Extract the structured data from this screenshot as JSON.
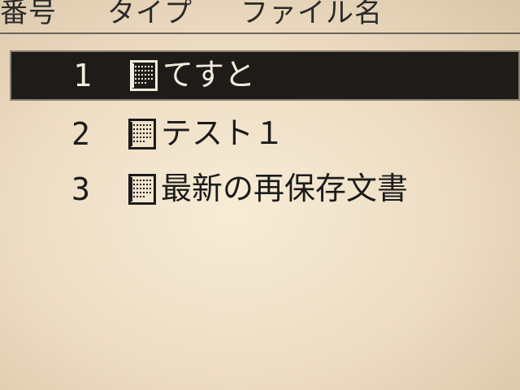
{
  "header": {
    "col_number": "番号",
    "col_type": "タイプ",
    "col_filename": "ファイル名"
  },
  "files": [
    {
      "number": "1",
      "name": "てすと",
      "selected": true
    },
    {
      "number": "2",
      "name": "テスト１",
      "selected": false
    },
    {
      "number": "3",
      "name": "最新の再保存文書",
      "selected": false
    }
  ],
  "icons": {
    "file_type_icon": "document-icon"
  },
  "colors": {
    "selection_background": "#1f1b18",
    "selection_text": "#f3ece0",
    "screen_background": "#eddcc2"
  }
}
